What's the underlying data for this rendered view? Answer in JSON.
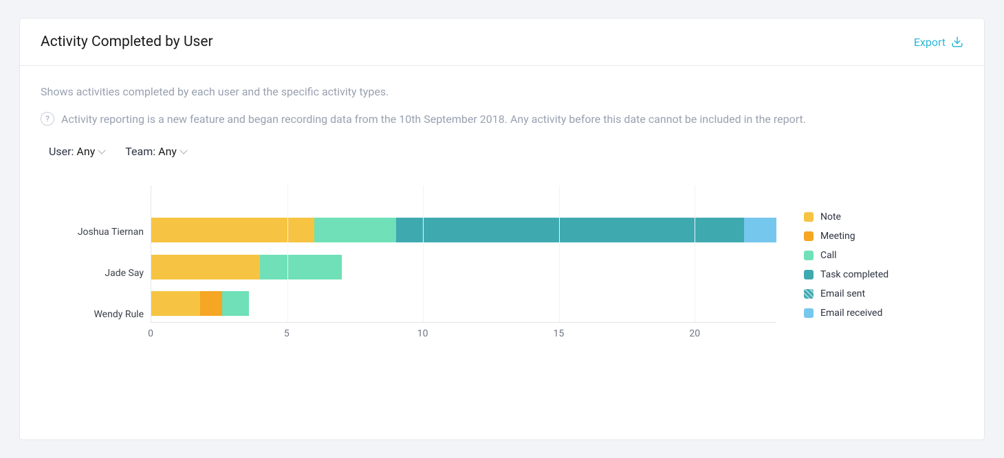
{
  "header": {
    "title": "Activity Completed by User",
    "export_label": "Export"
  },
  "description": "Shows activities completed by each user and the specific activity types.",
  "notice": "Activity reporting is a new feature and began recording data from the 10th September 2018. Any activity before this date cannot be included in the report.",
  "filters": {
    "user_label": "User:",
    "user_value": "Any",
    "team_label": "Team:",
    "team_value": "Any"
  },
  "legend": {
    "items": [
      {
        "label": "Note",
        "color": "#f6c442"
      },
      {
        "label": "Meeting",
        "color": "#f5a623"
      },
      {
        "label": "Call",
        "color": "#6fe0b7"
      },
      {
        "label": "Task completed",
        "color": "#3fa9b0"
      },
      {
        "label": "Email sent",
        "color": "#3fa9b0",
        "hatched": true
      },
      {
        "label": "Email received",
        "color": "#76c7ee"
      }
    ]
  },
  "chart_data": {
    "type": "bar",
    "orientation": "horizontal",
    "stacked": true,
    "xlabel": "",
    "ylabel": "",
    "xlim": [
      0,
      23
    ],
    "x_ticks": [
      0,
      5,
      10,
      15,
      20
    ],
    "categories": [
      "Joshua Tiernan",
      "Jade Say",
      "Wendy Rule"
    ],
    "series": [
      {
        "name": "Note",
        "color": "#f6c442",
        "values": [
          6.0,
          4.0,
          1.8
        ]
      },
      {
        "name": "Meeting",
        "color": "#f5a623",
        "values": [
          0.0,
          0.0,
          0.8
        ]
      },
      {
        "name": "Call",
        "color": "#6fe0b7",
        "values": [
          3.0,
          3.0,
          1.0
        ]
      },
      {
        "name": "Task completed",
        "color": "#3fa9b0",
        "values": [
          12.8,
          0.0,
          0.0
        ]
      },
      {
        "name": "Email sent",
        "color": "#3fa9b0",
        "values": [
          0.0,
          0.0,
          0.0
        ]
      },
      {
        "name": "Email received",
        "color": "#76c7ee",
        "values": [
          1.2,
          0.0,
          0.0
        ]
      }
    ]
  }
}
